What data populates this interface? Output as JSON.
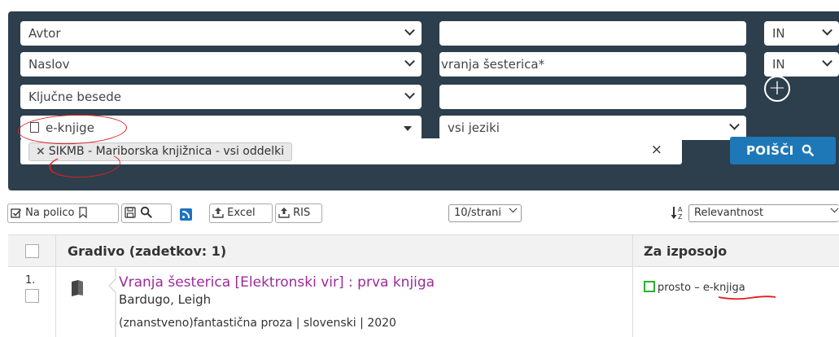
{
  "search": {
    "rows": [
      {
        "field": "Avtor",
        "value": "",
        "operator": "IN"
      },
      {
        "field": "Naslov",
        "value": "vranja šesterica*",
        "operator": "IN"
      },
      {
        "field": "Ključne besede",
        "value": ""
      }
    ],
    "material_type": "e-knjige",
    "language": "vsi jeziki",
    "library_tag": "SIKMB - Mariborska knjižnica - vsi oddelki",
    "tag_remove": "×",
    "clear": "×",
    "search_button": "POIŠČI"
  },
  "toolbar": {
    "shelf_label": "Na polico",
    "excel_label": "Excel",
    "ris_label": "RIS",
    "per_page": "10/strani",
    "sort": "Relevantnost"
  },
  "table": {
    "col_material": "Gradivo   (zadetkov: 1)",
    "col_loan": "Za izposojo",
    "rows": [
      {
        "num": "1.",
        "title": "Vranja šesterica [Elektronski vir] : prva knjiga",
        "author": "Bardugo, Leigh",
        "meta": "(znanstveno)fantastična proza | slovenski | 2020",
        "availability": "prosto",
        "availability_sep": " – ",
        "availability_type": "e-knjiga"
      }
    ]
  },
  "colors": {
    "panel": "#2d3e4c",
    "search_button": "#1e78b8",
    "title_link": "#9c2a9c",
    "available": "#2bb02b",
    "annotation": "#e02020"
  }
}
